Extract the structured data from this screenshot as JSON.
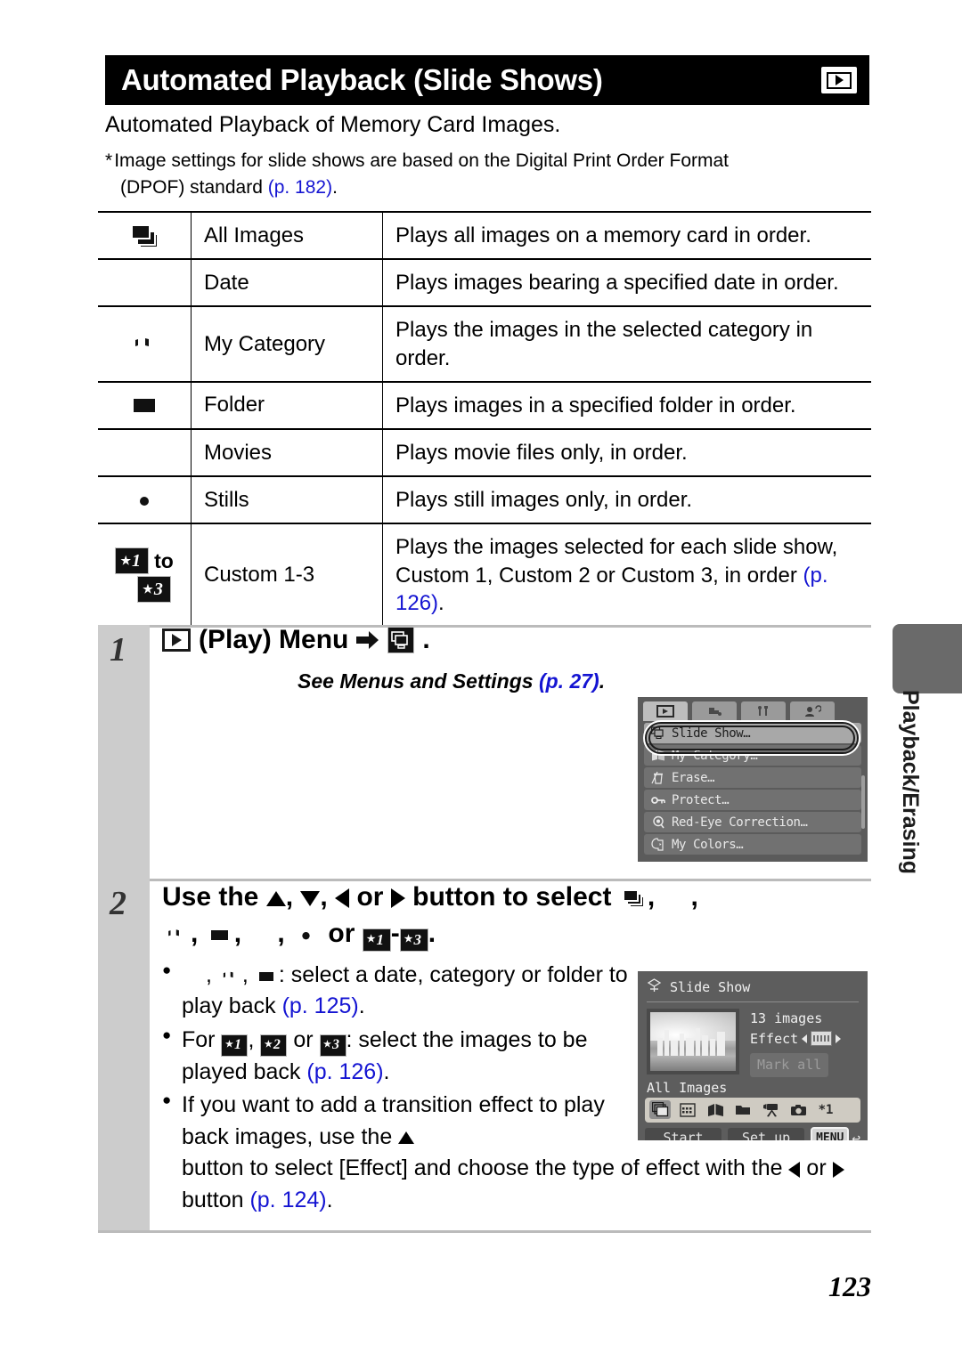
{
  "header": {
    "title": "Automated Playback (Slide Shows)",
    "badge_icon": "play-icon"
  },
  "intro": {
    "line": "Automated Playback of Memory Card Images.",
    "note_star": "*",
    "note_line1": "Image settings for slide shows are based on the Digital Print Order Format",
    "note_line2_prefix": "(DPOF) standard ",
    "note_line2_ref": "(p. 182)",
    "note_line2_suffix": "."
  },
  "table": {
    "rows": [
      {
        "icon": "all-images-icon",
        "name": "All Images",
        "desc": "Plays all images on a memory card in order."
      },
      {
        "icon": "date-icon",
        "name": "Date",
        "desc": "Plays images bearing a specified date in order."
      },
      {
        "icon": "my-category-icon",
        "name": "My Category",
        "desc": "Plays the images in the selected category in order."
      },
      {
        "icon": "folder-icon",
        "name": "Folder",
        "desc": "Plays images in a specified folder in order."
      },
      {
        "icon": "movies-icon",
        "name": "Movies",
        "desc": "Plays movie files only, in order."
      },
      {
        "icon": "stills-icon",
        "name": "Stills",
        "desc": "Plays still images only, in order."
      },
      {
        "icon": "custom-1-to-3-icon",
        "name": "Custom 1-3",
        "desc_prefix": "Plays the images selected for each slide show, Custom 1, Custom 2 or Custom 3, in order ",
        "desc_ref": "(p. 126)",
        "desc_suffix": "."
      }
    ],
    "custom_icon_labels": {
      "star1": "1",
      "to": "to",
      "star3": "3"
    }
  },
  "step1": {
    "number": "1",
    "title_text": "(Play) Menu",
    "title_end": ".",
    "see_prefix": "See Menus and Settings ",
    "see_ref": "(p. 27)",
    "see_suffix": "."
  },
  "lcd_menu": {
    "tabs": [
      "play-tab",
      "print-tab",
      "settings-tab",
      "mycamera-tab"
    ],
    "items": [
      {
        "icon": "slide-show-icon",
        "label": "Slide Show…",
        "selected": true
      },
      {
        "icon": "my-category-icon",
        "label": "My Category…",
        "selected": false
      },
      {
        "icon": "erase-icon",
        "label": "Erase…",
        "selected": false
      },
      {
        "icon": "protect-icon",
        "label": "Protect…",
        "selected": false
      },
      {
        "icon": "red-eye-icon",
        "label": "Red-Eye Correction…",
        "selected": false
      },
      {
        "icon": "my-colors-icon",
        "label": "My Colors…",
        "selected": false
      }
    ]
  },
  "step2": {
    "number": "2",
    "head_part1": "Use the",
    "head_comma1": ",",
    "head_comma2": ",",
    "head_or": "or",
    "head_part2": "button to select",
    "head_comma3": ",",
    "head_comma4": ",",
    "head_comma5": ",",
    "head_comma6": ",",
    "head_comma7": ",",
    "head_or2": "or",
    "head_dash": "-",
    "head_period": ".",
    "bullets": [
      {
        "comma": ",",
        "text_after_icons": ": select a date, category or folder to play back ",
        "ref": "(p. 125)",
        "suffix": "."
      },
      {
        "lead": "For",
        "comma": ",",
        "or": "or",
        "text_after_icons": ": select the images to be played back ",
        "ref": "(p. 126)",
        "suffix": "."
      },
      {
        "text1": "If you want to add a transition effect to play back images, use the",
        "text2": "button to select [Effect] and choose the type of effect with the",
        "text_or": "or",
        "text3": "button ",
        "ref": "(p. 124)",
        "suffix": "."
      }
    ]
  },
  "lcd_slideshow": {
    "title": "Slide Show",
    "title_icon": "slide-show-icon",
    "image_count": "13 images",
    "effect_label": "Effect",
    "mark_all": "Mark all",
    "mode_label": "All Images",
    "mode_icons": [
      "all-images-icon",
      "date-icon",
      "my-category-icon",
      "folder-icon",
      "movies-icon",
      "stills-icon",
      "custom-1-icon"
    ],
    "custom_star_label": "*1",
    "btn_start": "Start",
    "btn_setup": "Set up",
    "btn_menu": "MENU",
    "return_arrow": "↩"
  },
  "side_tab": {
    "label": "Playback/Erasing"
  },
  "footer": {
    "page_number": "123"
  },
  "colors": {
    "link": "#1414d2",
    "header_bg": "#000000",
    "step_col_bg": "#cccccc",
    "side_tab_bg": "#6a6a6a",
    "lcd_bg": "#5b5b5b"
  }
}
